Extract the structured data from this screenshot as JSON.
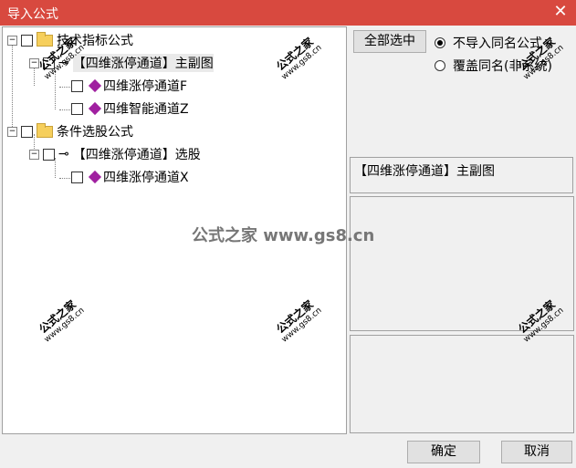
{
  "window": {
    "title": "导入公式"
  },
  "tree": {
    "groups": [
      {
        "label": "技术指标公式",
        "subgroup": {
          "label": "【四维涨停通道】主副图",
          "items": [
            {
              "label": "四维涨停通道F"
            },
            {
              "label": "四维智能通道Z"
            }
          ]
        }
      },
      {
        "label": "条件选股公式",
        "subgroup": {
          "label": "【四维涨停通道】选股",
          "items": [
            {
              "label": "四维涨停通道X"
            }
          ]
        }
      }
    ]
  },
  "options": {
    "select_all_label": "全部选中",
    "radio_no_import": "不导入同名公式",
    "radio_overwrite": "覆盖同名(非系统)",
    "selected_radio": "no_import"
  },
  "preview": {
    "text": "【四维涨停通道】主副图"
  },
  "footer": {
    "ok_label": "确定",
    "cancel_label": "取消"
  },
  "watermark": {
    "center_text": "公式之家 www.gs8.cn",
    "small_title": "公式之家",
    "small_url": "www.gs8.cn"
  }
}
